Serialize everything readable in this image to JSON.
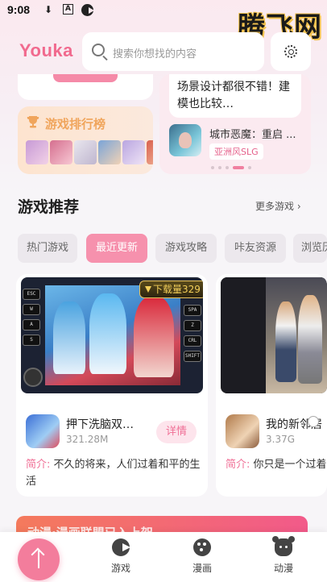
{
  "status_bar": {
    "time": "9:08",
    "icons": [
      "download-icon",
      "a-box-icon",
      "pacman-icon"
    ]
  },
  "watermark": "腾飞网",
  "header": {
    "logo": "Youka",
    "search_placeholder": "搜索你想找的内容",
    "settings_icon": "gear-icon"
  },
  "ranking": {
    "title": "游戏排行榜",
    "icon": "trophy-icon"
  },
  "feature": {
    "text": "场景设计都很不错！建模也比较…",
    "game_name": "城市恶魔：重启 ...",
    "tag": "亚洲风SLG",
    "carousel_dots": 6,
    "active_dot": 4
  },
  "section": {
    "title": "游戏推荐",
    "more": "更多游戏 ›",
    "tabs": [
      {
        "label": "热门游戏",
        "active": false
      },
      {
        "label": "最近更新",
        "active": true
      },
      {
        "label": "游戏攻略",
        "active": false
      },
      {
        "label": "咔友资源",
        "active": false
      },
      {
        "label": "浏览历史",
        "active": false
      }
    ]
  },
  "games": [
    {
      "download_badge": "下载量329",
      "name": "押下洗脑双…",
      "size": "321.28M",
      "detail_label": "详情",
      "desc_label": "简介:",
      "desc": "不久的将来，人们过着和平的生活",
      "keys_left": [
        "ESC",
        "W",
        "A",
        "S"
      ],
      "keys_right": [
        "SPA",
        "Z",
        "CRL",
        "SHIFT"
      ]
    },
    {
      "name": "我的新邻居",
      "size": "3.37G",
      "desc_label": "简介:",
      "desc": "你只是一个过着"
    }
  ],
  "banner": {
    "text": "动漫·漫画联盟已入上架"
  },
  "bottom_nav": {
    "fab_icon": "arrow-up-icon",
    "items": [
      {
        "label": "游戏",
        "icon": "pacman-icon"
      },
      {
        "label": "漫画",
        "icon": "palette-icon"
      },
      {
        "label": "动漫",
        "icon": "bear-icon"
      }
    ]
  },
  "colors": {
    "accent": "#f37d9c",
    "logo": "#f16a8e",
    "gold": "#f3cf5a"
  }
}
